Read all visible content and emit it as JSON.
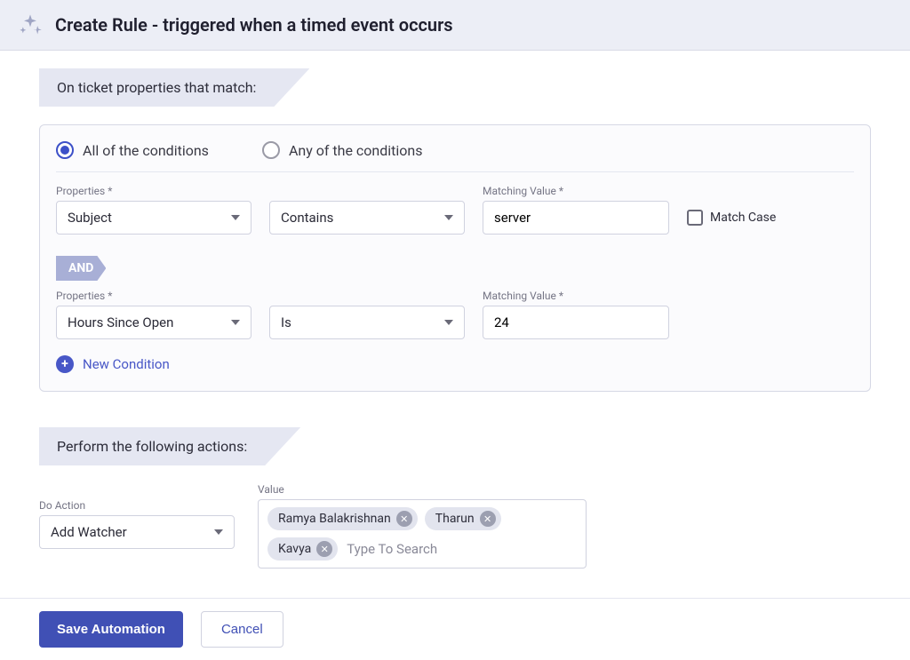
{
  "header": {
    "title": "Create Rule - triggered when a timed event occurs"
  },
  "conditions": {
    "banner": "On ticket properties that match:",
    "mode_all_label": "All of the conditions",
    "mode_any_label": "Any of the conditions",
    "selected_mode": "all",
    "labels": {
      "properties": "Properties *",
      "matching_value": "Matching Value *",
      "match_case": "Match Case",
      "and": "AND",
      "new_condition": "New Condition"
    },
    "rows": [
      {
        "property": "Subject",
        "operator": "Contains",
        "value": "server",
        "show_match_case": true
      },
      {
        "property": "Hours Since Open",
        "operator": "Is",
        "value": "24",
        "show_match_case": false
      }
    ]
  },
  "actions": {
    "banner": "Perform the following actions:",
    "labels": {
      "do_action": "Do Action",
      "value": "Value",
      "search_placeholder": "Type To Search"
    },
    "action_select": "Add Watcher",
    "tags": [
      "Ramya Balakrishnan",
      "Tharun",
      "Kavya"
    ]
  },
  "footer": {
    "save": "Save Automation",
    "cancel": "Cancel"
  }
}
